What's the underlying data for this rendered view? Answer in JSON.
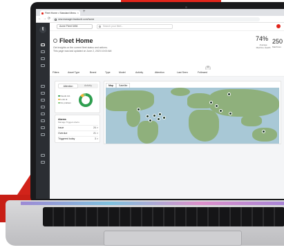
{
  "browser": {
    "tab_title": "Fleet Home • Standard Menu",
    "tab_close": "×",
    "new_tab": "+",
    "url": "new.manager.trackunit.com/home",
    "nav_back": "←",
    "nav_forward": "→",
    "nav_reload": "⟳"
  },
  "app": {
    "logo": "t",
    "fleet_selector": "Acme Fleet 3454",
    "search_placeholder": "Search your fleet...",
    "page_title": "Fleet Home",
    "subtitle": "Get insights on the current fleet status and actions.",
    "updated": "This page was last updated on June 2, 2023 10:00 AM",
    "collapse_glyph": "^",
    "stats": [
      {
        "value": "74%",
        "label": "Average Machine Health"
      },
      {
        "value": "250",
        "label": "Machines"
      }
    ]
  },
  "filters": {
    "label": "Filters",
    "items": [
      "Asset Type",
      "Brand",
      "Type",
      "Model",
      "Activity",
      "Attention",
      "Last Seen",
      "Followed"
    ]
  },
  "status_card": {
    "tabs": [
      "Attention",
      "Activity"
    ],
    "legend": [
      {
        "label": "Needs Act.",
        "color": "#2e9e4f"
      },
      {
        "label": "Look at",
        "color": "#f2b43c"
      },
      {
        "label": "No problem",
        "color": "#7cc576"
      }
    ]
  },
  "alarms_card": {
    "title": "Alarms",
    "subtitle": "Manage Triggers Alerts",
    "rows": [
      {
        "label": "Issue",
        "value": "24 >"
      },
      {
        "label": "Overdue",
        "value": "21 >"
      },
      {
        "label": "Triggered today",
        "value": "3 >"
      }
    ]
  },
  "map_card": {
    "tabs": [
      "Map",
      "Satellite"
    ]
  }
}
